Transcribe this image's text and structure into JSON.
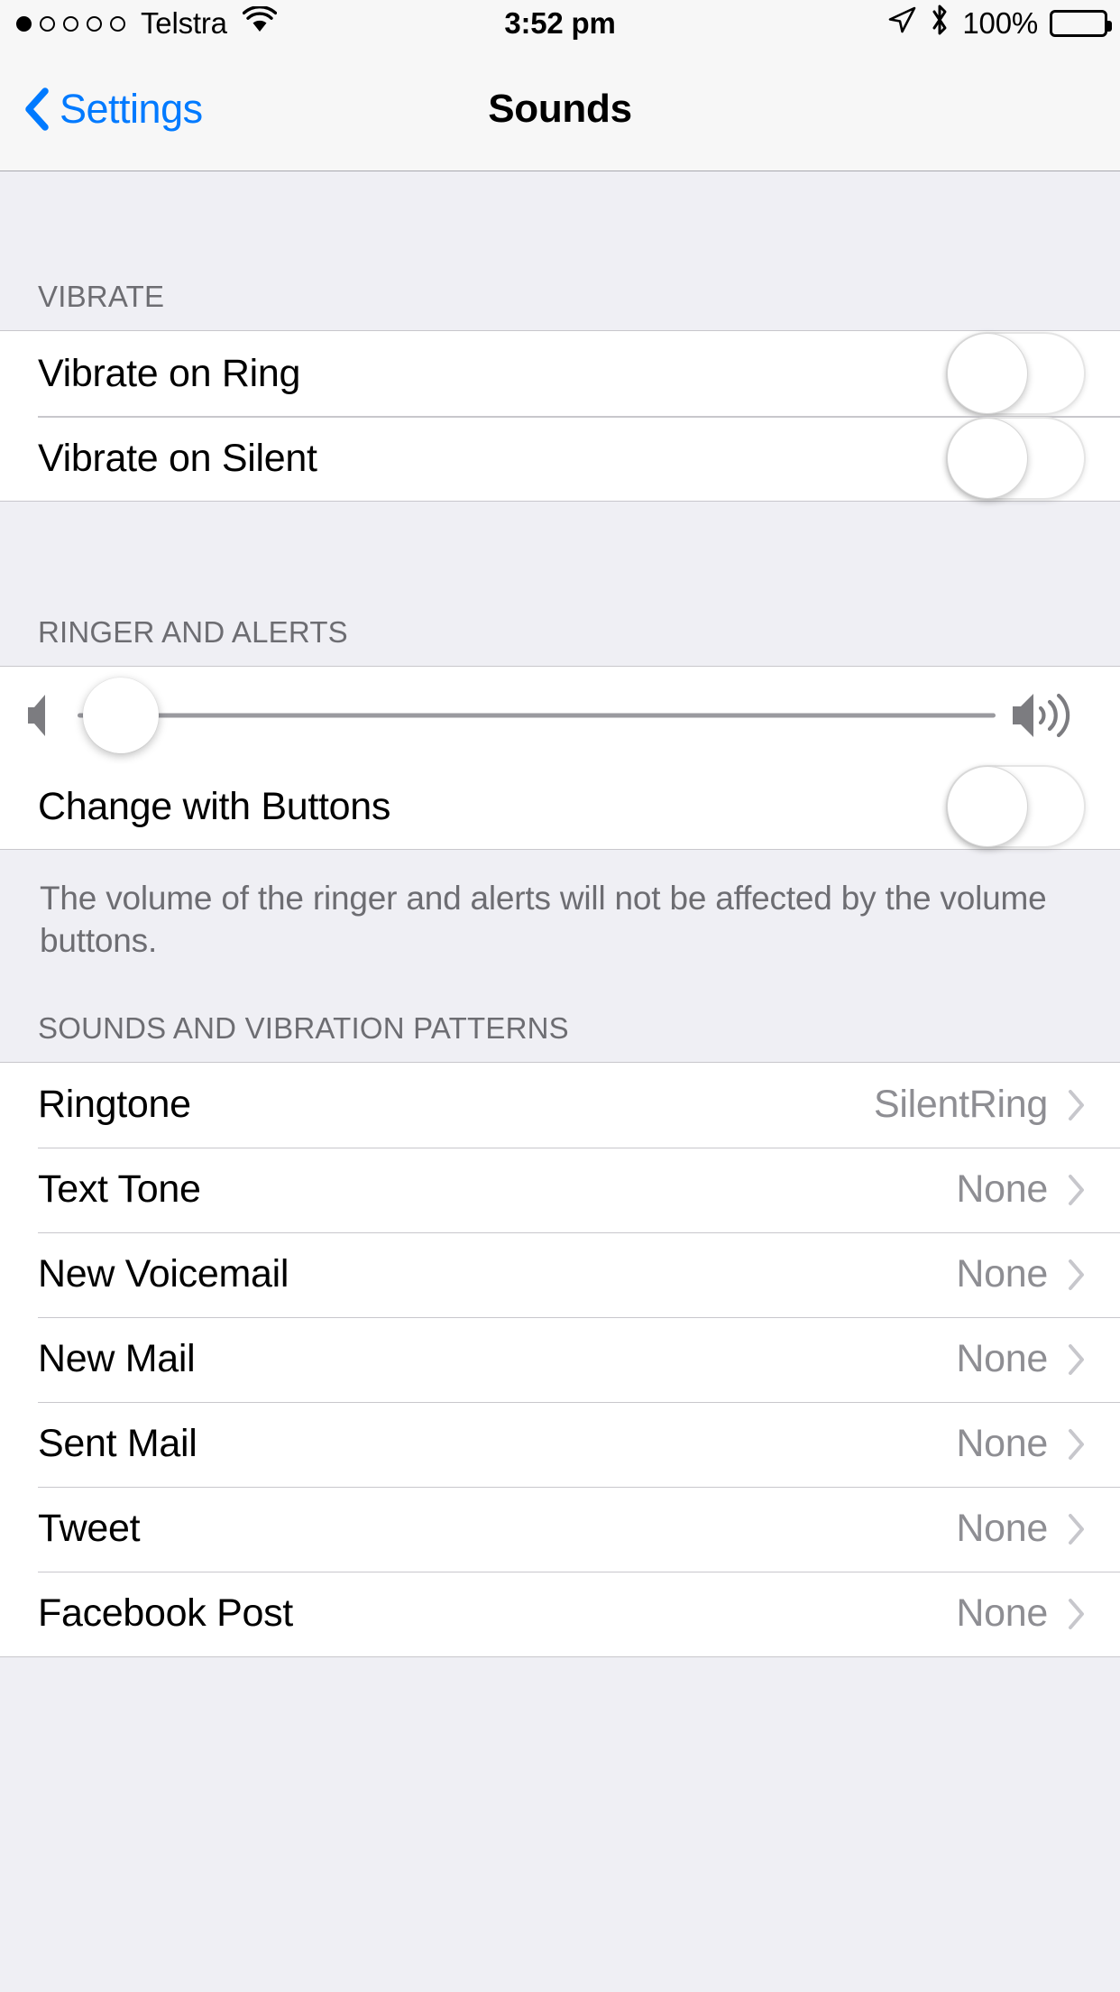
{
  "statusbar": {
    "signal_filled": 1,
    "signal_total": 5,
    "carrier": "Telstra",
    "wifi_icon": "wifi-icon",
    "time": "3:52 pm",
    "location_icon": "location-arrow-icon",
    "bluetooth_icon": "bluetooth-icon",
    "battery_percent": "100%",
    "battery_icon": "battery-full-icon"
  },
  "navbar": {
    "back_label": "Settings",
    "back_icon": "chevron-left-icon",
    "title": "Sounds",
    "accent_color": "#007AFF"
  },
  "sections": {
    "vibrate": {
      "header": "VIBRATE",
      "rows": [
        {
          "label": "Vibrate on Ring",
          "toggle": "off"
        },
        {
          "label": "Vibrate on Silent",
          "toggle": "off"
        }
      ]
    },
    "ringer": {
      "header": "RINGER AND ALERTS",
      "slider": {
        "low_icon": "speaker-low-icon",
        "high_icon": "speaker-high-icon",
        "value_percent": 4
      },
      "change_with_buttons": {
        "label": "Change with Buttons",
        "toggle": "off"
      },
      "footer": "The volume of the ringer and alerts will not be affected by the volume buttons."
    },
    "sounds": {
      "header": "SOUNDS AND VIBRATION PATTERNS",
      "rows": [
        {
          "label": "Ringtone",
          "value": "SilentRing",
          "chevron": "chevron-right-icon"
        },
        {
          "label": "Text Tone",
          "value": "None",
          "chevron": "chevron-right-icon"
        },
        {
          "label": "New Voicemail",
          "value": "None",
          "chevron": "chevron-right-icon"
        },
        {
          "label": "New Mail",
          "value": "None",
          "chevron": "chevron-right-icon"
        },
        {
          "label": "Sent Mail",
          "value": "None",
          "chevron": "chevron-right-icon"
        },
        {
          "label": "Tweet",
          "value": "None",
          "chevron": "chevron-right-icon"
        },
        {
          "label": "Facebook Post",
          "value": "None",
          "chevron": "chevron-right-icon"
        }
      ]
    }
  },
  "colors": {
    "accent": "#007AFF",
    "group_bg": "#EFEFF4",
    "cell_bg": "#FFFFFF",
    "separator": "#C8C7CC",
    "secondary_text": "#8E8E93",
    "header_text": "#6D6D72"
  }
}
